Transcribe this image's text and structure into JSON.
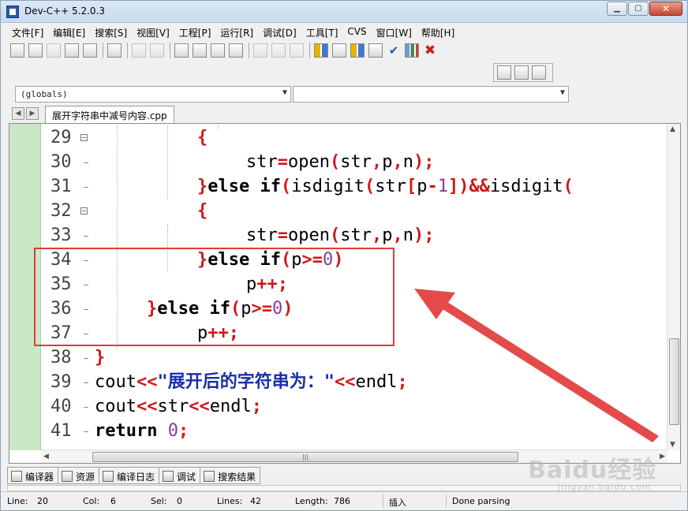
{
  "window": {
    "title": "Dev-C++ 5.2.0.3"
  },
  "menu": [
    "文件[F]",
    "编辑[E]",
    "搜索[S]",
    "视图[V]",
    "工程[P]",
    "运行[R]",
    "调试[D]",
    "工具[T]",
    "CVS",
    "窗口[W]",
    "帮助[H]"
  ],
  "combos": {
    "class": "(globals)",
    "member": ""
  },
  "tab": {
    "filename": "展开字符串中减号内容.cpp"
  },
  "code_lines": [
    {
      "num": "29",
      "fold": true,
      "tokens": [
        [
          "op",
          "{"
        ]
      ]
    },
    {
      "num": "30",
      "fold": false,
      "tokens": [
        [
          "id",
          "str"
        ],
        [
          "op",
          "="
        ],
        [
          "id",
          "open"
        ],
        [
          "op",
          "("
        ],
        [
          "id",
          "str"
        ],
        [
          "op",
          ","
        ],
        [
          "id",
          "p"
        ],
        [
          "op",
          ","
        ],
        [
          "id",
          "n"
        ],
        [
          "op",
          ")"
        ],
        [
          "op",
          ";"
        ]
      ]
    },
    {
      "num": "31",
      "fold": false,
      "tokens": [
        [
          "op",
          "}"
        ],
        [
          "kw",
          "else if"
        ],
        [
          "op",
          "("
        ],
        [
          "id",
          "isdigit"
        ],
        [
          "op",
          "("
        ],
        [
          "id",
          "str"
        ],
        [
          "op",
          "["
        ],
        [
          "id",
          "p"
        ],
        [
          "op",
          "-"
        ],
        [
          "num",
          "1"
        ],
        [
          "op",
          "]"
        ],
        [
          "op",
          ")"
        ],
        [
          "op",
          "&&"
        ],
        [
          "id",
          "isdigit"
        ],
        [
          "op",
          "("
        ]
      ]
    },
    {
      "num": "32",
      "fold": true,
      "tokens": [
        [
          "op",
          "{"
        ]
      ]
    },
    {
      "num": "33",
      "fold": false,
      "tokens": [
        [
          "id",
          "str"
        ],
        [
          "op",
          "="
        ],
        [
          "id",
          "open"
        ],
        [
          "op",
          "("
        ],
        [
          "id",
          "str"
        ],
        [
          "op",
          ","
        ],
        [
          "id",
          "p"
        ],
        [
          "op",
          ","
        ],
        [
          "id",
          "n"
        ],
        [
          "op",
          ")"
        ],
        [
          "op",
          ";"
        ]
      ]
    },
    {
      "num": "34",
      "fold": false,
      "tokens": [
        [
          "op",
          "}"
        ],
        [
          "kw",
          "else if"
        ],
        [
          "op",
          "("
        ],
        [
          "id",
          "p"
        ],
        [
          "op",
          ">="
        ],
        [
          "num",
          "0"
        ],
        [
          "op",
          ")"
        ]
      ]
    },
    {
      "num": "35",
      "fold": false,
      "tokens": [
        [
          "id",
          "p"
        ],
        [
          "op",
          "++"
        ],
        [
          "op",
          ";"
        ]
      ]
    },
    {
      "num": "36",
      "fold": false,
      "tokens": [
        [
          "op",
          "}"
        ],
        [
          "kw",
          "else if"
        ],
        [
          "op",
          "("
        ],
        [
          "id",
          "p"
        ],
        [
          "op",
          ">="
        ],
        [
          "num",
          "0"
        ],
        [
          "op",
          ")"
        ]
      ]
    },
    {
      "num": "37",
      "fold": false,
      "tokens": [
        [
          "id",
          "p"
        ],
        [
          "op",
          "++"
        ],
        [
          "op",
          ";"
        ]
      ]
    },
    {
      "num": "38",
      "fold": false,
      "tokens": [
        [
          "op",
          "}"
        ]
      ]
    },
    {
      "num": "39",
      "fold": false,
      "tokens": [
        [
          "id",
          "cout"
        ],
        [
          "op",
          "<<"
        ],
        [
          "str",
          "\"展开后的字符串为：\""
        ],
        [
          "op",
          "<<"
        ],
        [
          "id",
          "endl"
        ],
        [
          "op",
          ";"
        ]
      ]
    },
    {
      "num": "40",
      "fold": false,
      "tokens": [
        [
          "id",
          "cout"
        ],
        [
          "op",
          "<<"
        ],
        [
          "id",
          "str"
        ],
        [
          "op",
          "<<"
        ],
        [
          "id",
          "endl"
        ],
        [
          "op",
          ";"
        ]
      ]
    },
    {
      "num": "41",
      "fold": false,
      "tokens": [
        [
          "kw",
          "return"
        ],
        [
          "id",
          " "
        ],
        [
          "num",
          "0"
        ],
        [
          "op",
          ";"
        ]
      ]
    }
  ],
  "bottom_tabs": [
    "编译器",
    "资源",
    "编译日志",
    "调试",
    "搜索结果"
  ],
  "status": {
    "line_label": "Line:",
    "line": "20",
    "col_label": "Col:",
    "col": "6",
    "sel_label": "Sel:",
    "sel": "0",
    "lines_label": "Lines:",
    "lines": "42",
    "length_label": "Length:",
    "length": "786",
    "mode": "插入",
    "message": "Done parsing"
  },
  "watermark": {
    "brand": "Baidu经验",
    "sub": "jingyan.baidu.com"
  },
  "colors": {
    "keyword": "#000000",
    "operator": "#d01818",
    "number": "#8a3a9a",
    "string": "#1a2fa8",
    "annotation": "#e23a3a",
    "gutter": "#cbe8c6"
  }
}
